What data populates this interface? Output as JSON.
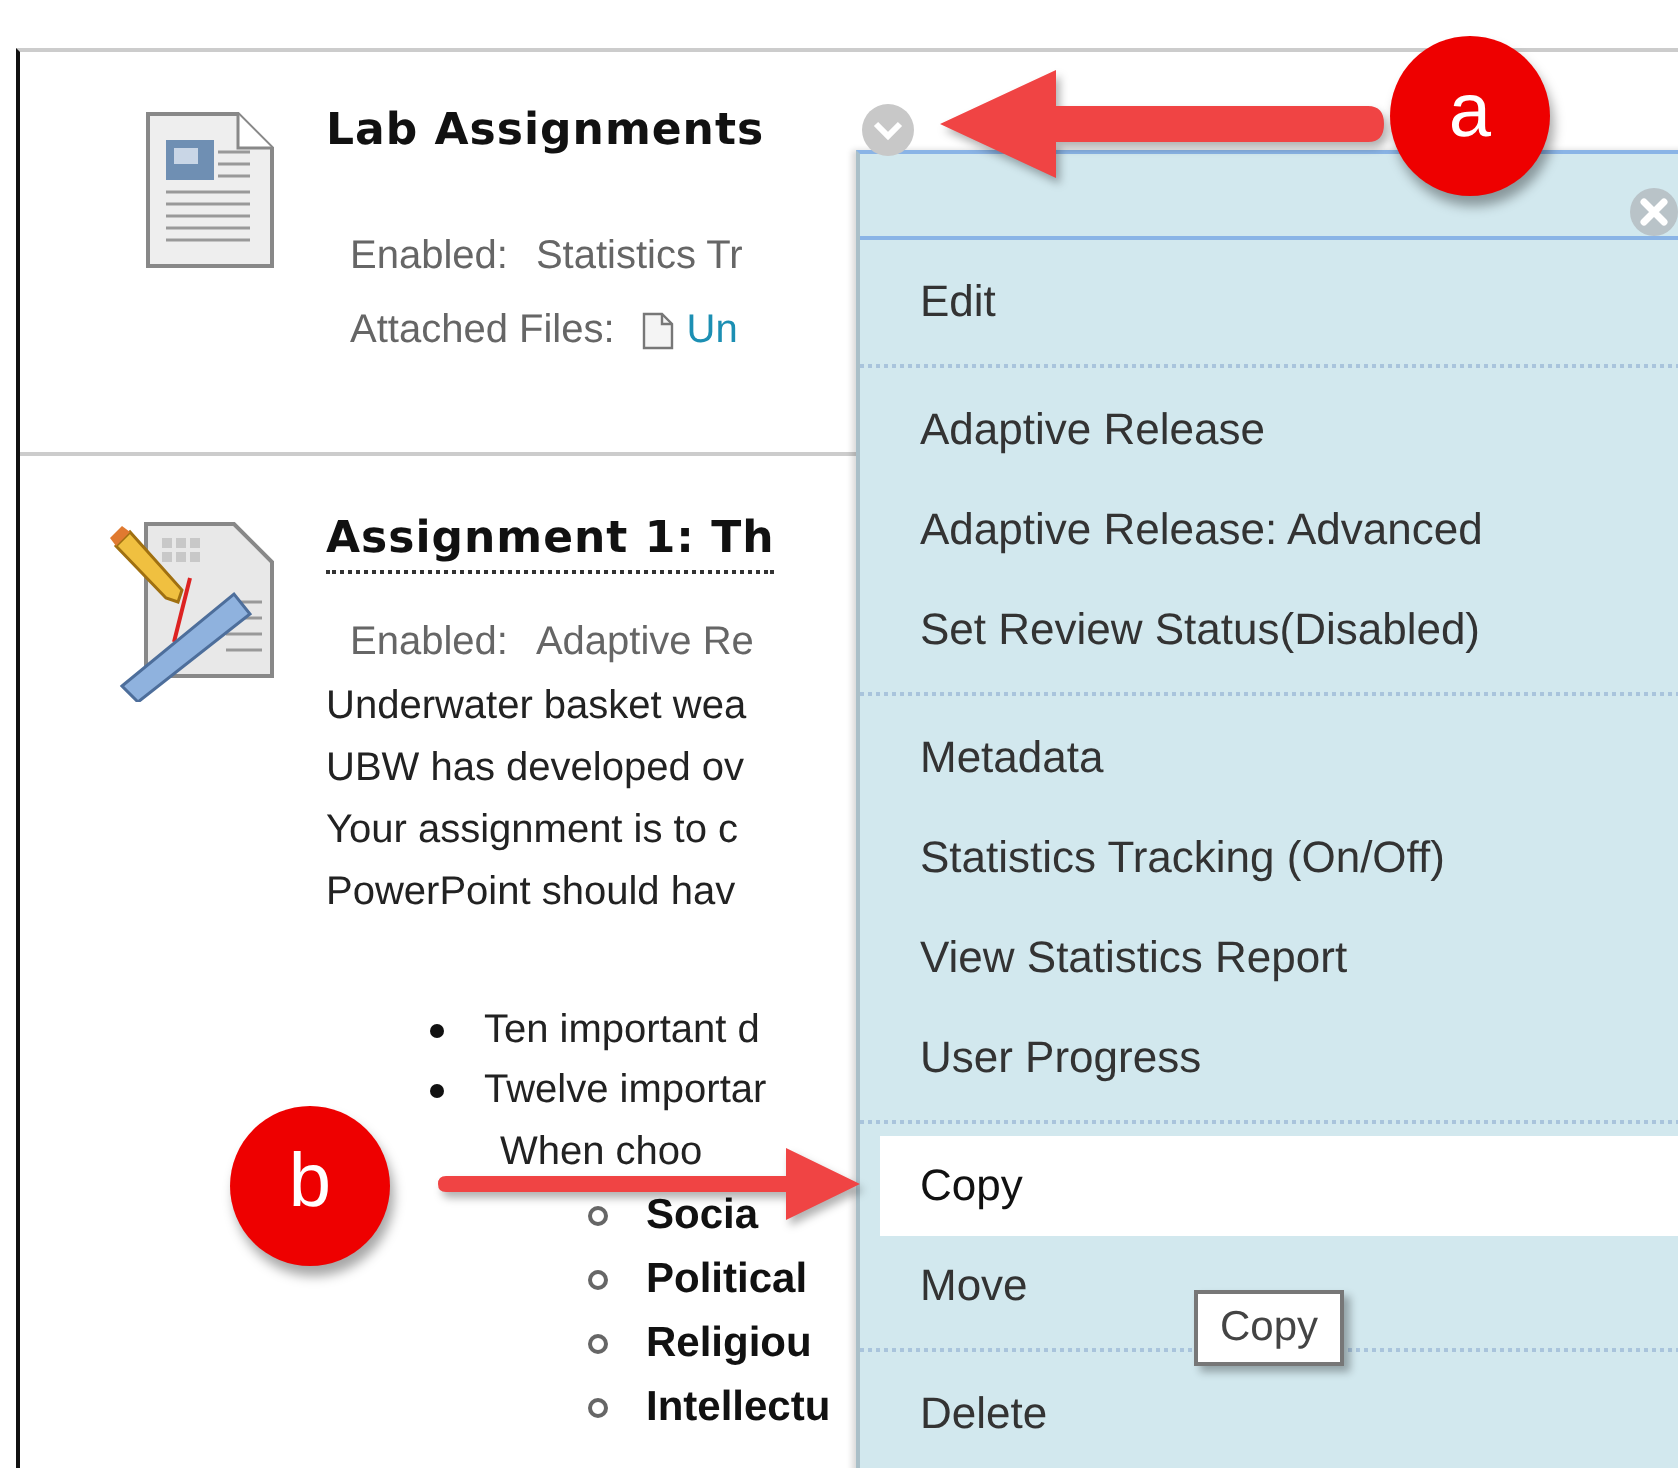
{
  "content_items": [
    {
      "kind": "document",
      "title": "Lab Assignments",
      "enabled_label": "Enabled:",
      "enabled_value": "Statistics Tr",
      "attached_label": "Attached Files:",
      "attached_file": "Un"
    },
    {
      "kind": "assignment",
      "title": "Assignment 1: Th",
      "enabled_label": "Enabled:",
      "enabled_value": "Adaptive Re",
      "paragraph": [
        "Underwater basket wea",
        "UBW has developed ov",
        "Your assignment is to c",
        "PowerPoint should hav"
      ],
      "bullets": [
        "Ten important d",
        "Twelve importar"
      ],
      "note": "When choo",
      "sub_bullets": [
        "Socia",
        "Political",
        "Religiou",
        "Intellectu"
      ]
    }
  ],
  "context_menu": {
    "groups": [
      [
        {
          "label": "Edit",
          "selected": false
        }
      ],
      [
        {
          "label": "Adaptive Release",
          "selected": false
        },
        {
          "label": "Adaptive Release: Advanced",
          "selected": false
        },
        {
          "label": "Set Review Status(Disabled)",
          "selected": false
        }
      ],
      [
        {
          "label": "Metadata",
          "selected": false
        },
        {
          "label": "Statistics Tracking (On/Off)",
          "selected": false
        },
        {
          "label": "View Statistics Report",
          "selected": false
        },
        {
          "label": "User Progress",
          "selected": false
        }
      ],
      [
        {
          "label": "Copy",
          "selected": true
        },
        {
          "label": "Move",
          "selected": false
        }
      ],
      [
        {
          "label": "Delete",
          "selected": false
        }
      ]
    ]
  },
  "tooltip": "Copy",
  "callouts": [
    {
      "label": "a"
    },
    {
      "label": "b"
    }
  ]
}
